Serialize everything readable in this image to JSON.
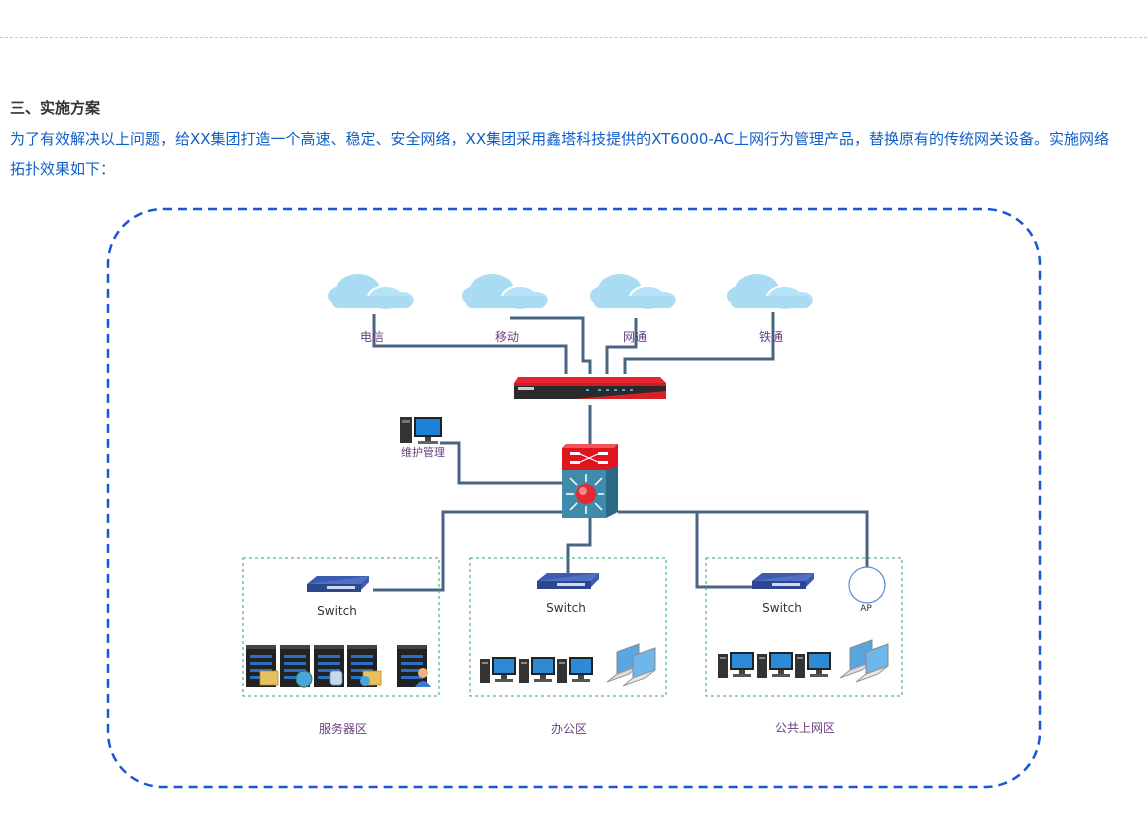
{
  "section": {
    "heading": "三、实施方案",
    "paragraph": "为了有效解决以上问题，给XX集团打造一个高速、稳定、安全网络，XX集团采用鑫塔科技提供的XT6000-AC上网行为管理产品，替换原有的传统网关设备。实施网络拓扑效果如下："
  },
  "topology": {
    "isps": [
      {
        "label": "电信"
      },
      {
        "label": "移动"
      },
      {
        "label": "网通"
      },
      {
        "label": "铁通"
      }
    ],
    "gateway": {
      "name": "XT6000-AC"
    },
    "management": {
      "label": "维护管理"
    },
    "zones": [
      {
        "label": "服务器区",
        "switch_label": "Switch"
      },
      {
        "label": "办公区",
        "switch_label": "Switch"
      },
      {
        "label": "公共上网区",
        "switch_label": "Switch",
        "ap_label": "AP"
      }
    ],
    "colors": {
      "frame": "#1a56d6",
      "link": "#4a6584",
      "zone_border": "#2aa37a",
      "cloud": "#a9dcf3",
      "gateway": "#d8202a",
      "label": "#6b3f7f"
    }
  }
}
